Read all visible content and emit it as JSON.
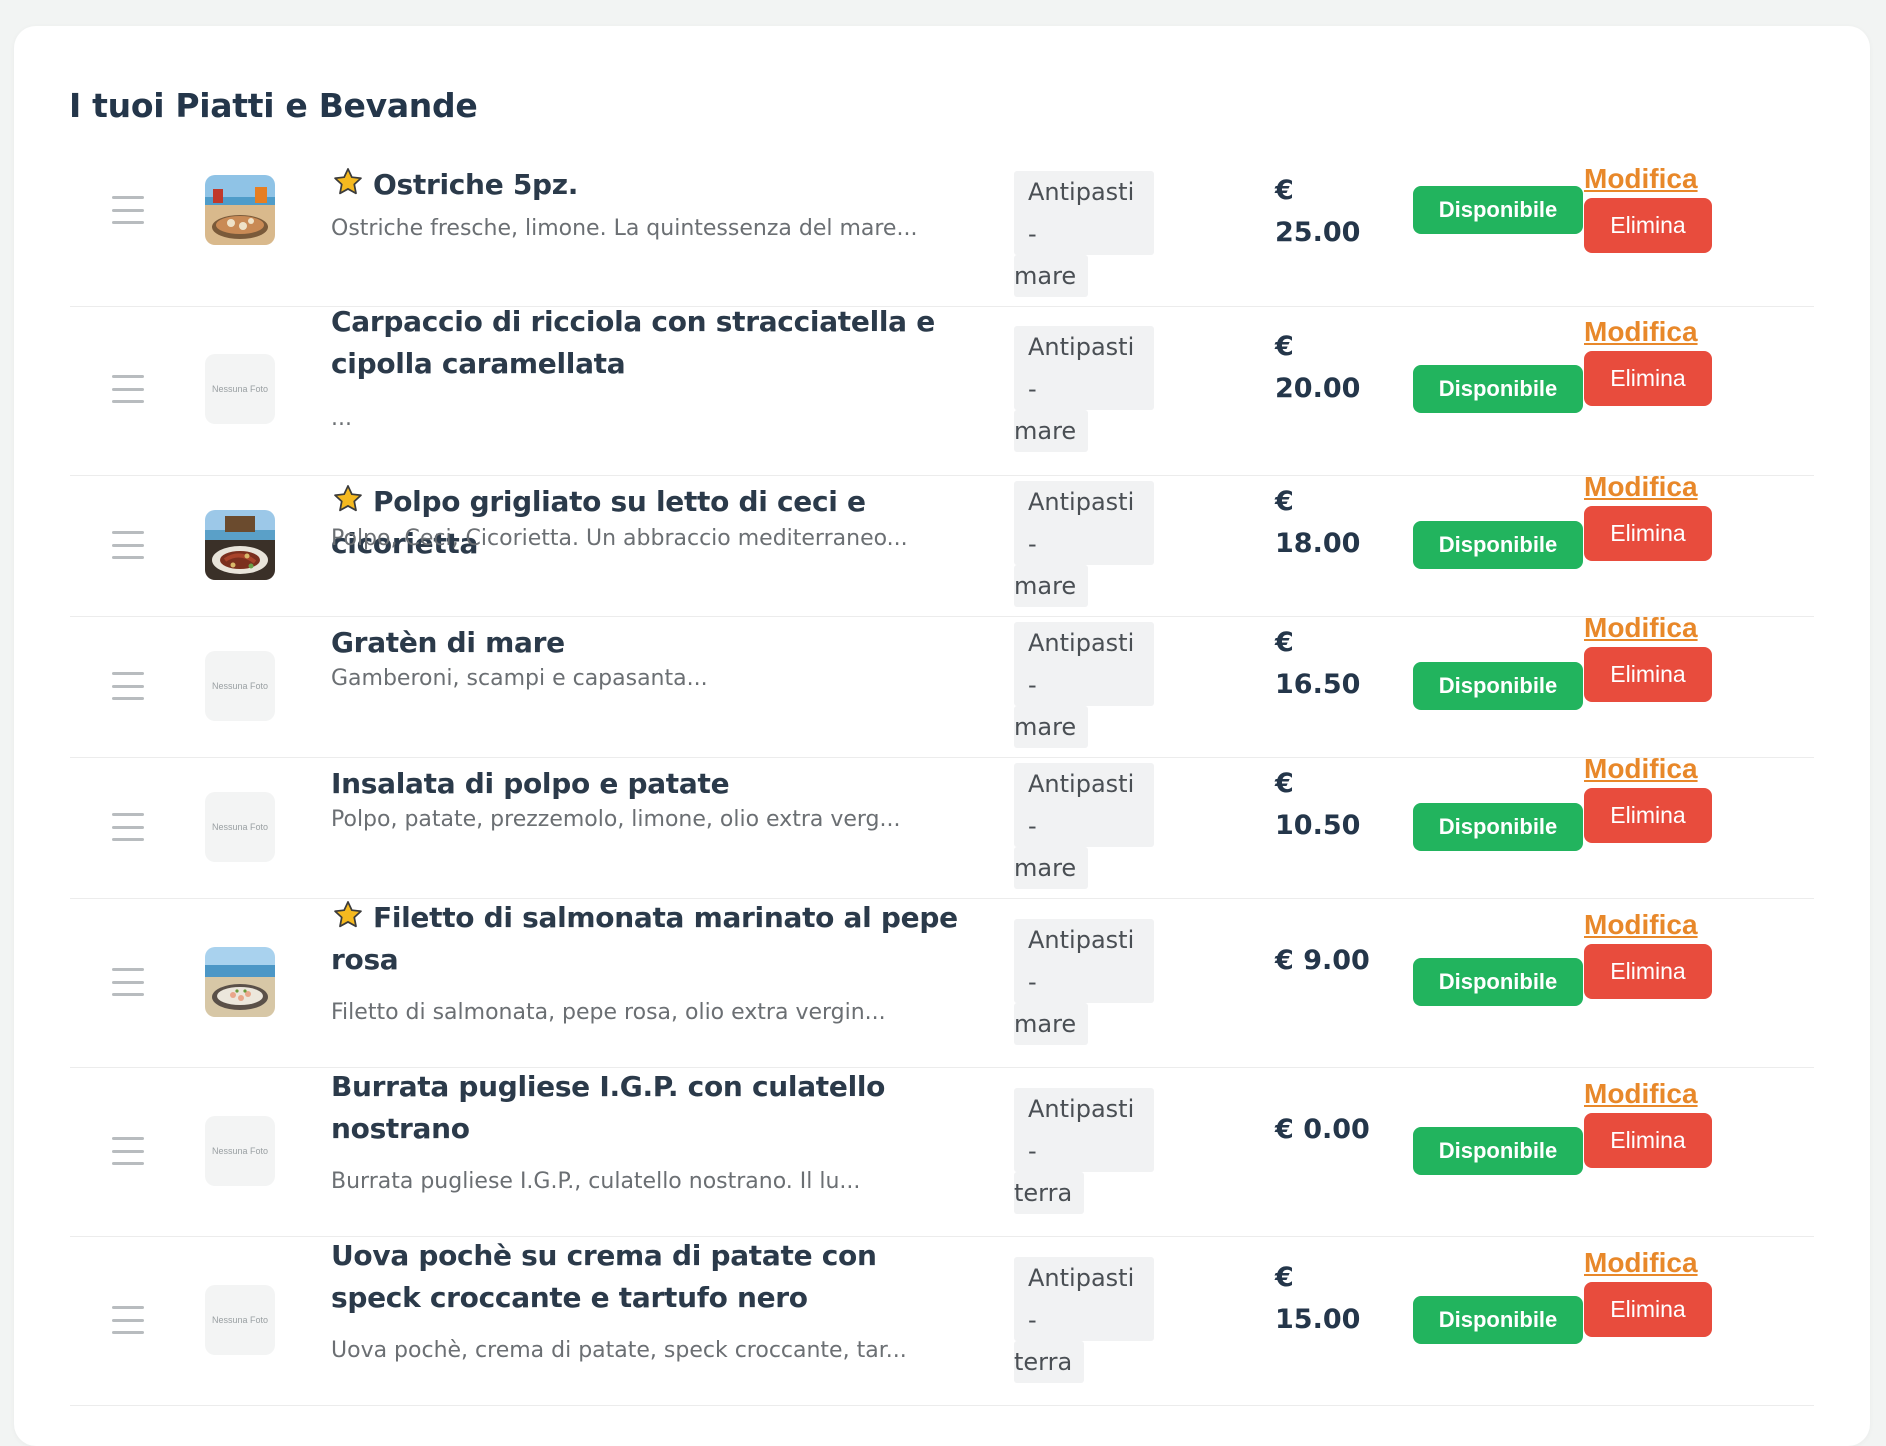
{
  "page": {
    "title": "I tuoi Piatti e Bevande",
    "no_photo_label": "Nessuna Foto"
  },
  "colors": {
    "available": "#22b45e",
    "edit": "#e8882a",
    "delete": "#e84c3d",
    "star": "#f5b91f"
  },
  "items": [
    {
      "name": "Ostriche 5pz.",
      "featured": true,
      "photo": "beach-restaurant-photo",
      "description": "Ostriche fresche, limone. La quintessenza del mare...",
      "category_line1": "Antipasti -",
      "category_line2": "mare",
      "price_symbol": "€",
      "price_value": "25.00",
      "status": "Disponibile",
      "edit_label": "Modifica",
      "delete_label": "Elimina"
    },
    {
      "name": "Carpaccio di ricciola con stracciatella e cipolla caramellata",
      "featured": false,
      "photo": null,
      "description": "...",
      "category_line1": "Antipasti -",
      "category_line2": "mare",
      "price_symbol": "€",
      "price_value": "20.00",
      "status": "Disponibile",
      "edit_label": "Modifica",
      "delete_label": "Elimina"
    },
    {
      "name": "Polpo grigliato su letto di ceci e cicorietta",
      "featured": true,
      "photo": "grilled-octopus-photo",
      "description": "Polpo, Ceci, Cicorietta. Un abbraccio mediterraneo...",
      "category_line1": "Antipasti -",
      "category_line2": "mare",
      "price_symbol": "€",
      "price_value": "18.00",
      "status": "Disponibile",
      "edit_label": "Modifica",
      "delete_label": "Elimina"
    },
    {
      "name": "Gratèn di mare",
      "featured": false,
      "photo": null,
      "description": "Gamberoni, scampi e capasanta...",
      "category_line1": "Antipasti -",
      "category_line2": "mare",
      "price_symbol": "€",
      "price_value": "16.50",
      "status": "Disponibile",
      "edit_label": "Modifica",
      "delete_label": "Elimina"
    },
    {
      "name": "Insalata di polpo e patate",
      "featured": false,
      "photo": null,
      "description": "Polpo, patate, prezzemolo, limone, olio extra verg...",
      "category_line1": "Antipasti -",
      "category_line2": "mare",
      "price_symbol": "€",
      "price_value": "10.50",
      "status": "Disponibile",
      "edit_label": "Modifica",
      "delete_label": "Elimina"
    },
    {
      "name": "Filetto di salmonata marinato al pepe rosa",
      "featured": true,
      "photo": "salmon-plate-photo",
      "description": "Filetto di salmonata, pepe rosa, olio extra vergin...",
      "category_line1": "Antipasti -",
      "category_line2": "mare",
      "price_symbol": "€",
      "price_value": "9.00",
      "status": "Disponibile",
      "edit_label": "Modifica",
      "delete_label": "Elimina"
    },
    {
      "name": "Burrata pugliese I.G.P. con culatello nostrano",
      "featured": false,
      "photo": null,
      "description": "Burrata pugliese I.G.P., culatello nostrano. Il lu...",
      "category_line1": "Antipasti -",
      "category_line2": "terra",
      "price_symbol": "€",
      "price_value": "0.00",
      "status": "Disponibile",
      "edit_label": "Modifica",
      "delete_label": "Elimina"
    },
    {
      "name": "Uova pochè su crema di patate con speck croccante e tartufo nero",
      "featured": false,
      "photo": null,
      "description": "Uova pochè, crema di patate, speck croccante, tar...",
      "category_line1": "Antipasti -",
      "category_line2": "terra",
      "price_symbol": "€",
      "price_value": "15.00",
      "status": "Disponibile",
      "edit_label": "Modifica",
      "delete_label": "Elimina"
    }
  ]
}
